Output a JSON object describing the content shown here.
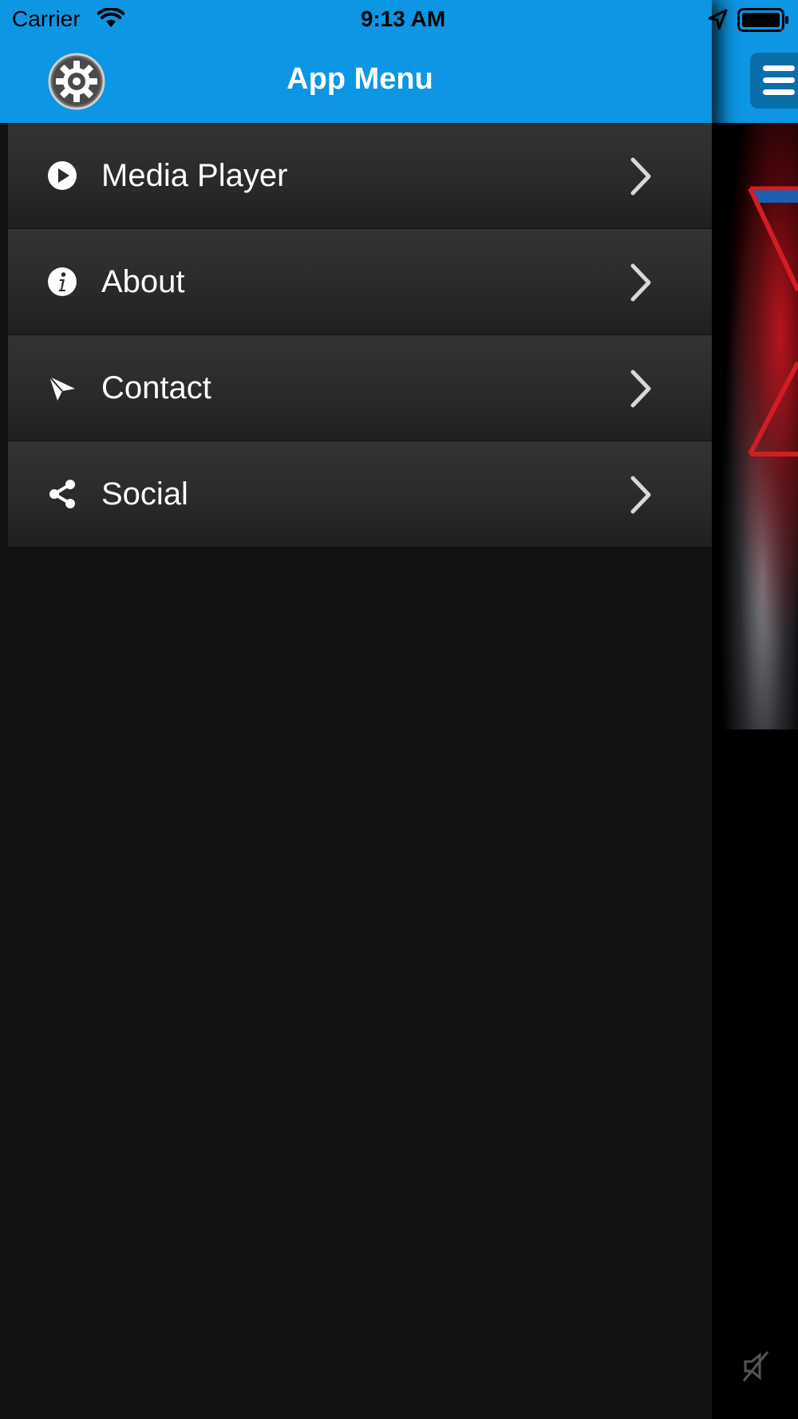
{
  "status_bar": {
    "carrier": "Carrier",
    "time": "9:13 AM"
  },
  "drawer": {
    "title": "App Menu",
    "items": [
      {
        "label": "Media Player",
        "icon": "play-circle-icon"
      },
      {
        "label": "About",
        "icon": "info-circle-icon"
      },
      {
        "label": "Contact",
        "icon": "paper-plane-icon"
      },
      {
        "label": "Social",
        "icon": "share-icon"
      }
    ]
  },
  "colors": {
    "header_blue": "#0c96e4",
    "drawer_bg": "#121212",
    "menu_item_bg": "#2a2a2a",
    "text": "#ffffff"
  }
}
